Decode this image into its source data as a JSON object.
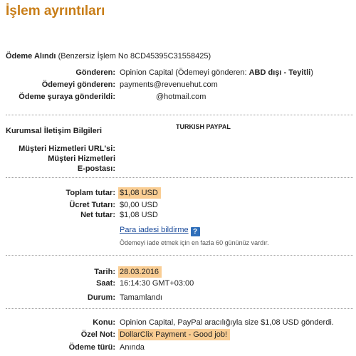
{
  "title": "İşlem ayrıntıları",
  "payment_received": {
    "label": "Ödeme Alındı",
    "detail": "(Benzersiz İşlem No 8CD45395C31558425)"
  },
  "sender": {
    "from_label": "Gönderen:",
    "from_prefix": "Opinion Capital (Ödemeyi gönderen: ",
    "from_bold": "ABD dışı - Teyitli",
    "from_suffix": ")",
    "sent_by_label": "Ödemeyi gönderen:",
    "sent_by_value": "payments@revenuehut.com",
    "sent_to_label": "Ödeme şuraya gönderildi:",
    "sent_to_value": "@hotmail.com"
  },
  "corporate": {
    "heading": "Kurumsal İletişim Bilgileri",
    "company": "TURKISH PAYPAL",
    "cs_url_label": "Müşteri Hizmetleri URL'si:",
    "cs_email_label_1": "Müşteri Hizmetleri",
    "cs_email_label_2": "E-postası:"
  },
  "amounts": {
    "total_label": "Toplam tutar:",
    "total_value": "$1,08 USD",
    "fee_label": "Ücret Tutarı:",
    "fee_value": "$0,00 USD",
    "net_label": "Net tutar:",
    "net_value": "$1,08 USD",
    "refund_link": "Para iadesi bildirme",
    "help_icon": "?",
    "refund_note": "Ödemeyi iade etmek için en fazla 60 gününüz vardır."
  },
  "timing": {
    "date_label": "Tarih:",
    "date_value": "28.03.2016",
    "time_label": "Saat:",
    "time_value": "16:14:30 GMT+03:00",
    "status_label": "Durum:",
    "status_value": "Tamamlandı"
  },
  "details": {
    "subject_label": "Konu:",
    "subject_value": "Opinion Capital, PayPal aracılığıyla size $1,08 USD gönderdi.",
    "note_label": "Özel Not:",
    "note_value": "DollarClix Payment - Good job!",
    "type_label": "Ödeme türü:",
    "type_value": "Anında"
  },
  "colors": {
    "title": "#c87d17",
    "highlight": "#f9cd93",
    "link": "#1a4a9a",
    "help_icon_bg": "#2f6fba"
  }
}
